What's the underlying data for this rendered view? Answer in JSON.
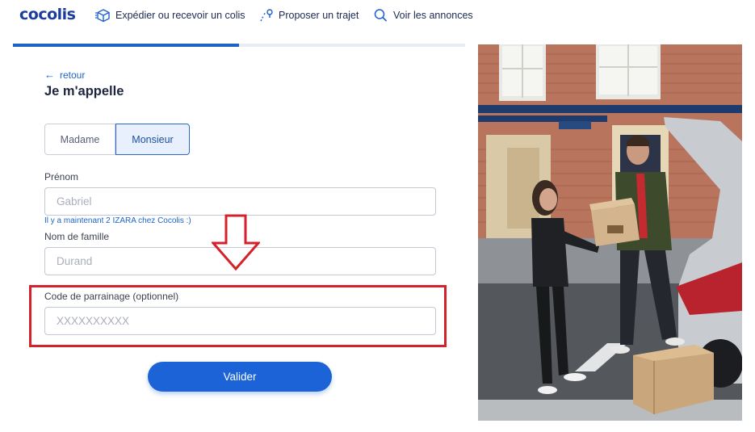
{
  "header": {
    "logo": "cocolis",
    "nav": [
      {
        "label": "Expédier ou recevoir un colis",
        "icon": "package-icon"
      },
      {
        "label": "Proposer un trajet",
        "icon": "route-icon"
      },
      {
        "label": "Voir les annonces",
        "icon": "search-icon"
      }
    ]
  },
  "progress": {
    "value": 0.5
  },
  "form": {
    "back_label": "retour",
    "title": "Je m'appelle",
    "gender": {
      "options": [
        "Madame",
        "Monsieur"
      ],
      "selected": "Monsieur"
    },
    "first_name": {
      "label": "Prénom",
      "placeholder": "Gabriel"
    },
    "hint": "Il y a maintenant 2 IZARA chez Cocolis :)",
    "last_name": {
      "label": "Nom de famille",
      "placeholder": "Durand"
    },
    "referral": {
      "label": "Code de parrainage (optionnel)",
      "placeholder": "XXXXXXXXXX"
    },
    "submit_label": "Valider"
  },
  "annotation": {
    "highlight_color": "#d4212a"
  },
  "colors": {
    "brand": "#1c3d9b",
    "accent": "#1b63d6"
  }
}
